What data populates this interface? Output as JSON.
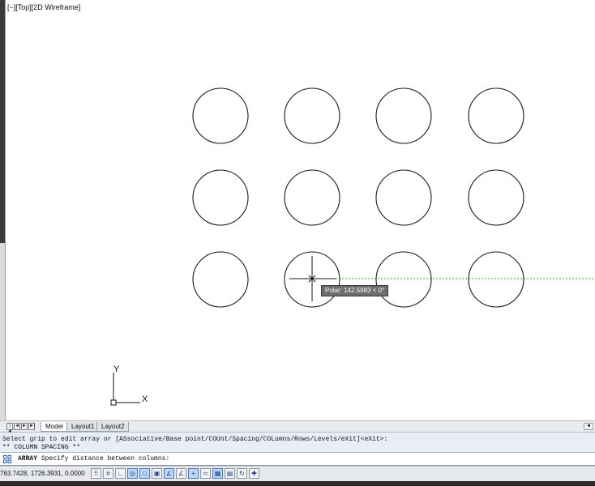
{
  "viewport": {
    "label": "[−][Top][2D Wireframe]",
    "polar_tooltip": "Polar: 142.5983 < 0°",
    "ucs_x_label": "X",
    "ucs_y_label": "Y",
    "array_grid": {
      "rows": 3,
      "columns": 4
    },
    "colors": {
      "tracking_line": "#22b522",
      "circle_stroke": "#1a1a1a"
    }
  },
  "tabs": {
    "nav": [
      "|◄",
      "◄",
      "►",
      "►|"
    ],
    "items": [
      {
        "label": "Model",
        "active": true
      },
      {
        "label": "Layout1",
        "active": false
      },
      {
        "label": "Layout2",
        "active": false
      }
    ]
  },
  "command": {
    "history": [
      "Select grip to edit array or [ASsociative/Base point/COUnt/Spacing/COLumns/Rows/Levels/eXit]<eXit>:",
      "** COLUMN SPACING **"
    ],
    "current_command": "ARRAY",
    "current_prompt": "Specify distance between columns:"
  },
  "statusbar": {
    "coordinates": "763.7428, 1726.3931, 0.0000",
    "toggles": [
      {
        "name": "snap-icon",
        "glyph": "⠿",
        "on": false
      },
      {
        "name": "grid-icon",
        "glyph": "#",
        "on": false
      },
      {
        "name": "ortho-icon",
        "glyph": "∟",
        "on": false
      },
      {
        "name": "polar-icon",
        "glyph": "◎",
        "on": true
      },
      {
        "name": "osnap-icon",
        "glyph": "□",
        "on": true
      },
      {
        "name": "3dosnap-icon",
        "glyph": "▣",
        "on": false
      },
      {
        "name": "otrack-icon",
        "glyph": "∠",
        "on": true
      },
      {
        "name": "ducs-icon",
        "glyph": "∠",
        "on": false
      },
      {
        "name": "dyn-icon",
        "glyph": "+",
        "on": true
      },
      {
        "name": "lineweight-icon",
        "glyph": "═",
        "on": false
      },
      {
        "name": "transparency-icon",
        "glyph": "▦",
        "on": true
      },
      {
        "name": "quickprops-icon",
        "glyph": "▤",
        "on": false
      },
      {
        "name": "selection-cycling-icon",
        "glyph": "↻",
        "on": false
      },
      {
        "name": "annotation-monitor-icon",
        "glyph": "✚",
        "on": false
      }
    ]
  }
}
